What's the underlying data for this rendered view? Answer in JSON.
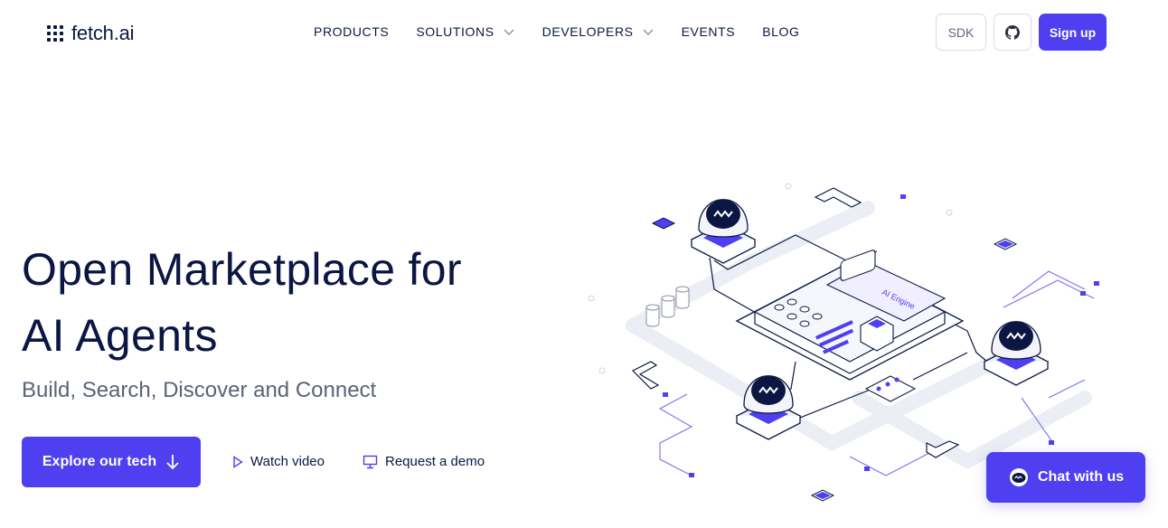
{
  "brand": {
    "name": "fetch.ai"
  },
  "nav": {
    "items": [
      {
        "label": "PRODUCTS",
        "dropdown": false
      },
      {
        "label": "SOLUTIONS",
        "dropdown": true
      },
      {
        "label": "DEVELOPERS",
        "dropdown": true
      },
      {
        "label": "EVENTS",
        "dropdown": false
      },
      {
        "label": "BLOG",
        "dropdown": false
      }
    ]
  },
  "header_actions": {
    "sdk_label": "SDK",
    "github_icon": "github-icon",
    "signup_label": "Sign up"
  },
  "hero": {
    "title_line1": "Open Marketplace for",
    "title_line2": "AI Agents",
    "subtitle": "Build, Search, Discover and Connect",
    "explore_label": "Explore our tech",
    "watch_label": "Watch video",
    "demo_label": "Request a demo"
  },
  "illustration": {
    "engine_label": "AI Engine"
  },
  "chat": {
    "label": "Chat with us"
  },
  "colors": {
    "accent": "#4e3ff0",
    "text": "#0b1742",
    "muted": "#5b6378"
  }
}
